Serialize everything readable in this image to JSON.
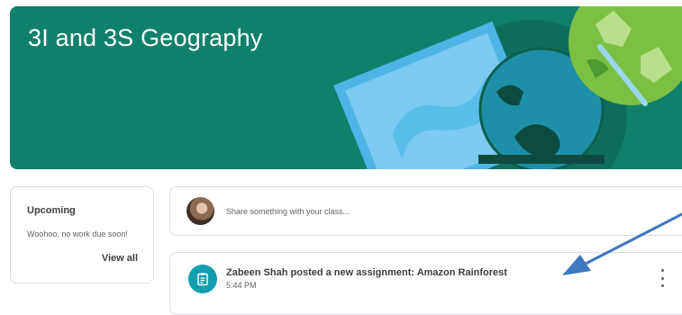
{
  "banner": {
    "title": "3I and 3S Geography",
    "colors": {
      "background": "#11806a"
    }
  },
  "upcoming": {
    "title": "Upcoming",
    "message": "Woohoo, no work due soon!",
    "view_all_label": "View all"
  },
  "share": {
    "avatar_icon": "user-avatar",
    "placeholder": "Share something with your class..."
  },
  "stream": {
    "posts": [
      {
        "icon": "assignment-icon",
        "title": "Zabeen Shah posted a new assignment: Amazon Rainforest",
        "time": "5:44 PM",
        "menu_icon": "more-vert-icon"
      }
    ]
  },
  "annotation": {
    "arrow_color": "#3f77c0"
  }
}
